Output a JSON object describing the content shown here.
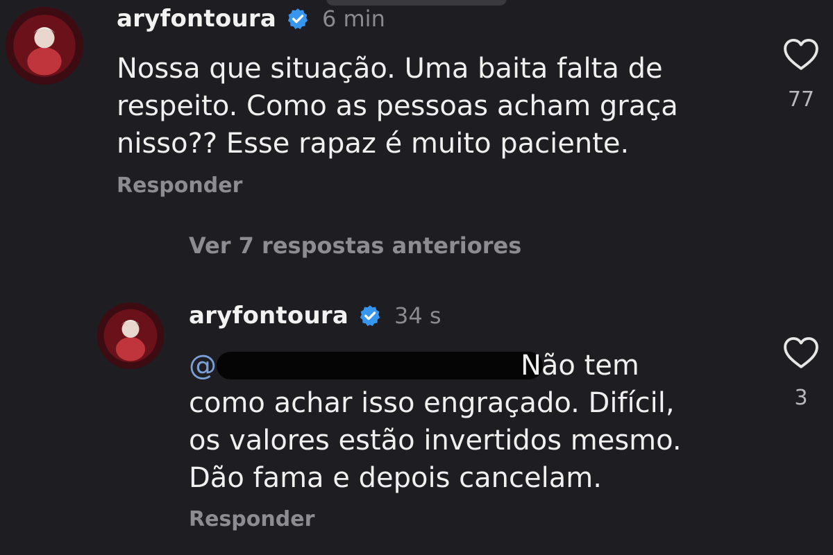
{
  "comments": [
    {
      "username": "aryfontoura",
      "time": "6 min",
      "text": "Nossa que situação. Uma baita falta de\nrespeito. Como as pessoas acham graça\nnisso?? Esse rapaz é muito paciente.",
      "reply_label": "Responder",
      "likes": "77",
      "icons": {
        "avatar": "avatar",
        "verified": "verified-badge-icon",
        "like": "heart-icon"
      },
      "colors": {
        "verified": "#3797f0"
      }
    },
    {
      "username": "aryfontoura",
      "time": "34 s",
      "mention_at": "@",
      "text": "Não tem\ncomo achar isso engraçado. Difícil,\nos valores estão invertidos mesmo.\nDão fama e depois cancelam.",
      "reply_label": "Responder",
      "likes": "3"
    }
  ],
  "view_more_label": "Ver 7 respostas anteriores",
  "theme": {
    "background": "#1e1e22",
    "muted_text": "#8c8c92"
  }
}
